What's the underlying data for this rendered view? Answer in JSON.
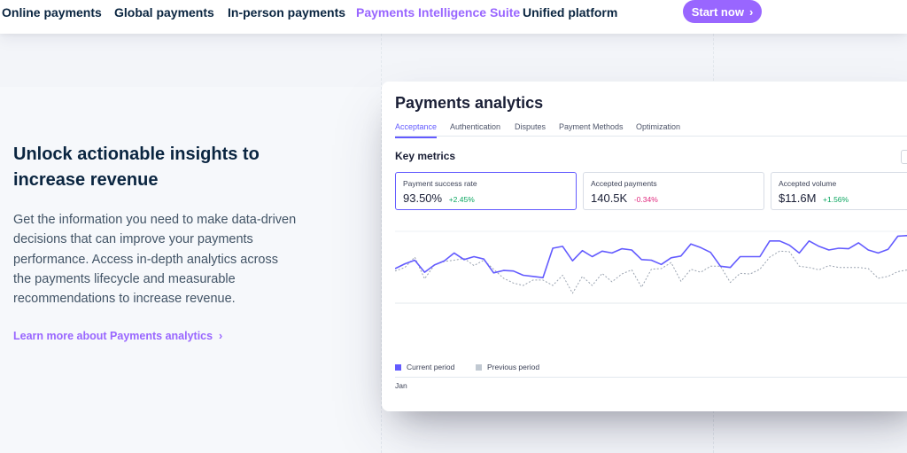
{
  "nav": {
    "items": [
      {
        "label": "Online payments",
        "active": false
      },
      {
        "label": "Global payments",
        "active": false
      },
      {
        "label": "In-person payments",
        "active": false
      },
      {
        "label": "Payments Intelligence Suite",
        "active": true
      },
      {
        "label": "Unified platform",
        "active": false
      }
    ],
    "cta_label": "Start now",
    "cta_icon": "chevron-right-icon"
  },
  "hero": {
    "headline": "Unlock actionable insights to increase revenue",
    "body": "Get the information you need to make data-driven decisions that can improve your payments performance. Access in-depth analytics across the payments lifecycle and measurable recommendations to increase revenue.",
    "link_label": "Learn more about Payments analytics"
  },
  "card": {
    "title": "Payments analytics",
    "tabs": [
      "Acceptance",
      "Authentication",
      "Disputes",
      "Payment Methods",
      "Optimization"
    ],
    "active_tab": "Acceptance",
    "key_metrics_title": "Key metrics",
    "metrics": [
      {
        "label": "Payment success rate",
        "value": "93.50%",
        "delta": "+2.45%",
        "trend": "positive",
        "active": true
      },
      {
        "label": "Accepted payments",
        "value": "140.5K",
        "delta": "-0.34%",
        "trend": "negative",
        "active": false
      },
      {
        "label": "Accepted volume",
        "value": "$11.6M",
        "delta": "+1.56%",
        "trend": "positive",
        "active": false
      }
    ],
    "legend": [
      {
        "label": "Current period",
        "color": "#635bff"
      },
      {
        "label": "Previous period",
        "color": "#c1c9d2"
      }
    ],
    "x_tick": "Jan"
  },
  "colors": {
    "accent": "#9966ff",
    "chart_current": "#635bff",
    "chart_previous": "#9aa3b0",
    "positive": "#09a55f",
    "negative": "#e0287d"
  },
  "chart_data": {
    "type": "line",
    "series": [
      {
        "name": "Current period",
        "values": [
          56,
          64,
          70,
          50,
          62,
          69,
          82,
          71,
          76,
          72,
          49,
          53,
          52,
          45,
          43,
          41,
          90,
          93,
          69,
          86,
          76,
          85,
          82,
          89,
          87,
          71,
          70,
          63,
          74,
          77,
          97,
          91,
          83,
          60,
          58,
          76,
          76,
          76,
          102,
          102,
          95,
          82,
          102,
          93,
          87,
          90,
          89,
          99,
          87,
          82,
          88,
          110,
          111,
          102
        ]
      },
      {
        "name": "Previous period",
        "values": [
          52,
          58,
          75,
          39,
          62,
          68,
          70,
          73,
          61,
          70,
          55,
          40,
          32,
          28,
          37,
          37,
          28,
          45,
          15,
          43,
          28,
          48,
          34,
          47,
          54,
          25,
          55,
          56,
          66,
          35,
          55,
          50,
          60,
          60,
          33,
          48,
          47,
          55,
          75,
          85,
          84,
          60,
          58,
          54,
          61,
          58,
          58,
          58,
          56,
          40,
          43,
          51,
          54,
          67
        ]
      }
    ],
    "xlabel": "",
    "ylabel": ""
  }
}
